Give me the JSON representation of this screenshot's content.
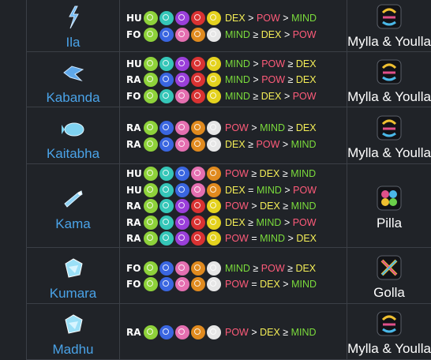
{
  "colors": {
    "background": "#202328",
    "border": "#3b3f46",
    "hero_name": "#4aa3e8",
    "pair_name": "#ffffff",
    "stat_DEX": "#f4ee57",
    "stat_POW": "#ff5b7a",
    "stat_MIND": "#7bdc3c",
    "operator": "#ffffff"
  },
  "orb_colors": {
    "lime": "#8ed23a",
    "teal": "#35c6b8",
    "purple": "#9a3fd9",
    "red": "#d93232",
    "yellow": "#e4d21e",
    "blue": "#3a66e0",
    "pink": "#e46fb0",
    "orange": "#e08a1e",
    "white": "#e6e6e6"
  },
  "rows": [
    {
      "name": "Ila",
      "icon": "ila-lightning-icon",
      "pair": "Mylla & Youlla",
      "pair_icon": "mylla-youlla-icon",
      "effects": [
        {
          "cls": "HU",
          "orbs": [
            "lime",
            "teal",
            "purple",
            "red",
            "yellow"
          ],
          "formula": [
            {
              "t": "DEX",
              "c": "DEX"
            },
            {
              "t": " > ",
              "c": "op"
            },
            {
              "t": "POW",
              "c": "POW"
            },
            {
              "t": " > ",
              "c": "op"
            },
            {
              "t": "MIND",
              "c": "MIND"
            }
          ]
        },
        {
          "cls": "FO",
          "orbs": [
            "lime",
            "blue",
            "pink",
            "orange",
            "white"
          ],
          "formula": [
            {
              "t": "MIND",
              "c": "MIND"
            },
            {
              "t": " ≥ ",
              "c": "op"
            },
            {
              "t": "DEX",
              "c": "DEX"
            },
            {
              "t": " > ",
              "c": "op"
            },
            {
              "t": "POW",
              "c": "POW"
            }
          ]
        }
      ]
    },
    {
      "name": "Kabanda",
      "icon": "kabanda-fish-icon",
      "pair": "Mylla & Youlla",
      "pair_icon": "mylla-youlla-icon",
      "effects": [
        {
          "cls": "HU",
          "orbs": [
            "lime",
            "teal",
            "purple",
            "red",
            "yellow"
          ],
          "formula": [
            {
              "t": "MIND",
              "c": "MIND"
            },
            {
              "t": " > ",
              "c": "op"
            },
            {
              "t": "POW",
              "c": "POW"
            },
            {
              "t": " ≥ ",
              "c": "op"
            },
            {
              "t": "DEX",
              "c": "DEX"
            }
          ]
        },
        {
          "cls": "RA",
          "orbs": [
            "lime",
            "blue",
            "purple",
            "red",
            "yellow"
          ],
          "formula": [
            {
              "t": "MIND",
              "c": "MIND"
            },
            {
              "t": " > ",
              "c": "op"
            },
            {
              "t": "POW",
              "c": "POW"
            },
            {
              "t": " ≥ ",
              "c": "op"
            },
            {
              "t": "DEX",
              "c": "DEX"
            }
          ]
        },
        {
          "cls": "FO",
          "orbs": [
            "lime",
            "teal",
            "pink",
            "red",
            "yellow"
          ],
          "formula": [
            {
              "t": "MIND",
              "c": "MIND"
            },
            {
              "t": " ≥ ",
              "c": "op"
            },
            {
              "t": "DEX",
              "c": "DEX"
            },
            {
              "t": " > ",
              "c": "op"
            },
            {
              "t": "POW",
              "c": "POW"
            }
          ]
        }
      ]
    },
    {
      "name": "Kaitabha",
      "icon": "kaitabha-fish-icon",
      "pair": "Mylla & Youlla",
      "pair_icon": "mylla-youlla-icon",
      "effects": [
        {
          "cls": "RA",
          "orbs": [
            "lime",
            "blue",
            "pink",
            "orange",
            "white"
          ],
          "formula": [
            {
              "t": "POW",
              "c": "POW"
            },
            {
              "t": " > ",
              "c": "op"
            },
            {
              "t": "MIND",
              "c": "MIND"
            },
            {
              "t": " ≥ ",
              "c": "op"
            },
            {
              "t": "DEX",
              "c": "DEX"
            }
          ]
        },
        {
          "cls": "RA",
          "orbs": [
            "lime",
            "blue",
            "pink",
            "orange",
            "white"
          ],
          "formula": [
            {
              "t": "DEX",
              "c": "DEX"
            },
            {
              "t": " ≥ ",
              "c": "op"
            },
            {
              "t": "POW",
              "c": "POW"
            },
            {
              "t": " > ",
              "c": "op"
            },
            {
              "t": "MIND",
              "c": "MIND"
            }
          ]
        }
      ]
    },
    {
      "name": "Kama",
      "icon": "kama-bone-icon",
      "pair": "Pilla",
      "pair_icon": "pilla-icon",
      "effects": [
        {
          "cls": "HU",
          "orbs": [
            "lime",
            "teal",
            "blue",
            "pink",
            "orange"
          ],
          "formula": [
            {
              "t": "POW",
              "c": "POW"
            },
            {
              "t": " ≥ ",
              "c": "op"
            },
            {
              "t": "DEX",
              "c": "DEX"
            },
            {
              "t": " ≥ ",
              "c": "op"
            },
            {
              "t": "MIND",
              "c": "MIND"
            }
          ]
        },
        {
          "cls": "HU",
          "orbs": [
            "lime",
            "teal",
            "blue",
            "pink",
            "orange"
          ],
          "formula": [
            {
              "t": "DEX",
              "c": "DEX"
            },
            {
              "t": " = ",
              "c": "op"
            },
            {
              "t": "MIND",
              "c": "MIND"
            },
            {
              "t": " > ",
              "c": "op"
            },
            {
              "t": "POW",
              "c": "POW"
            }
          ]
        },
        {
          "cls": "RA",
          "orbs": [
            "lime",
            "teal",
            "purple",
            "red",
            "yellow"
          ],
          "formula": [
            {
              "t": "POW",
              "c": "POW"
            },
            {
              "t": " > ",
              "c": "op"
            },
            {
              "t": "DEX",
              "c": "DEX"
            },
            {
              "t": " ≥ ",
              "c": "op"
            },
            {
              "t": "MIND",
              "c": "MIND"
            }
          ]
        },
        {
          "cls": "RA",
          "orbs": [
            "lime",
            "teal",
            "purple",
            "red",
            "yellow"
          ],
          "formula": [
            {
              "t": "DEX",
              "c": "DEX"
            },
            {
              "t": " ≥ ",
              "c": "op"
            },
            {
              "t": "MIND",
              "c": "MIND"
            },
            {
              "t": " > ",
              "c": "op"
            },
            {
              "t": "POW",
              "c": "POW"
            }
          ]
        },
        {
          "cls": "RA",
          "orbs": [
            "lime",
            "teal",
            "purple",
            "red",
            "yellow"
          ],
          "formula": [
            {
              "t": "POW",
              "c": "POW"
            },
            {
              "t": " = ",
              "c": "op"
            },
            {
              "t": "MIND",
              "c": "MIND"
            },
            {
              "t": " > ",
              "c": "op"
            },
            {
              "t": "DEX",
              "c": "DEX"
            }
          ]
        }
      ]
    },
    {
      "name": "Kumara",
      "icon": "kumara-crystal-icon",
      "pair": "Golla",
      "pair_icon": "golla-icon",
      "effects": [
        {
          "cls": "FO",
          "orbs": [
            "lime",
            "blue",
            "pink",
            "orange",
            "white"
          ],
          "formula": [
            {
              "t": "MIND",
              "c": "MIND"
            },
            {
              "t": " ≥ ",
              "c": "op"
            },
            {
              "t": "POW",
              "c": "POW"
            },
            {
              "t": " ≥ ",
              "c": "op"
            },
            {
              "t": "DEX",
              "c": "DEX"
            }
          ]
        },
        {
          "cls": "FO",
          "orbs": [
            "lime",
            "blue",
            "pink",
            "orange",
            "white"
          ],
          "formula": [
            {
              "t": "POW",
              "c": "POW"
            },
            {
              "t": " = ",
              "c": "op"
            },
            {
              "t": "DEX",
              "c": "DEX"
            },
            {
              "t": " > ",
              "c": "op"
            },
            {
              "t": "MIND",
              "c": "MIND"
            }
          ]
        }
      ]
    },
    {
      "name": "Madhu",
      "icon": "madhu-crystal-icon",
      "pair": "Mylla & Youlla",
      "pair_icon": "mylla-youlla-icon",
      "effects": [
        {
          "cls": "RA",
          "orbs": [
            "lime",
            "blue",
            "pink",
            "orange",
            "white"
          ],
          "formula": [
            {
              "t": "POW",
              "c": "POW"
            },
            {
              "t": " > ",
              "c": "op"
            },
            {
              "t": "DEX",
              "c": "DEX"
            },
            {
              "t": " ≥ ",
              "c": "op"
            },
            {
              "t": "MIND",
              "c": "MIND"
            }
          ]
        }
      ]
    }
  ]
}
